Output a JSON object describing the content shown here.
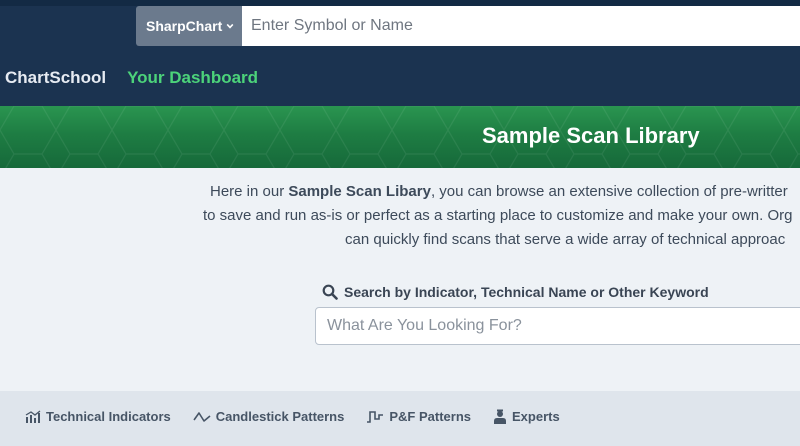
{
  "header": {
    "symbol_select": {
      "label": "SharpChart"
    },
    "symbol_input": {
      "placeholder": "Enter Symbol or Name"
    },
    "nav": [
      {
        "label": "ChartSchool"
      },
      {
        "label": "Your Dashboard"
      }
    ]
  },
  "banner": {
    "title": "Sample Scan Library"
  },
  "intro": {
    "line1_pre": "Here in our ",
    "line1_bold": "Sample Scan Libary",
    "line1_post": ", you can browse an extensive collection of pre-writter",
    "line2": "to save and run as-is or perfect as a starting place to customize and make your own. Org",
    "line3": "can quickly find scans that serve a wide array of technical approac"
  },
  "search": {
    "label": "Search by Indicator, Technical Name or Other Keyword",
    "placeholder": "What Are You Looking For?"
  },
  "tabs": [
    {
      "label": "Technical Indicators",
      "icon": "bar-chart-icon"
    },
    {
      "label": "Candlestick Patterns",
      "icon": "candlestick-wave-icon"
    },
    {
      "label": "P&F Patterns",
      "icon": "pnf-step-icon"
    },
    {
      "label": "Experts",
      "icon": "expert-person-icon"
    }
  ],
  "colors": {
    "navy": "#1b3350",
    "green_accent": "#4cd37a",
    "banner_green": "#1e7d43"
  }
}
